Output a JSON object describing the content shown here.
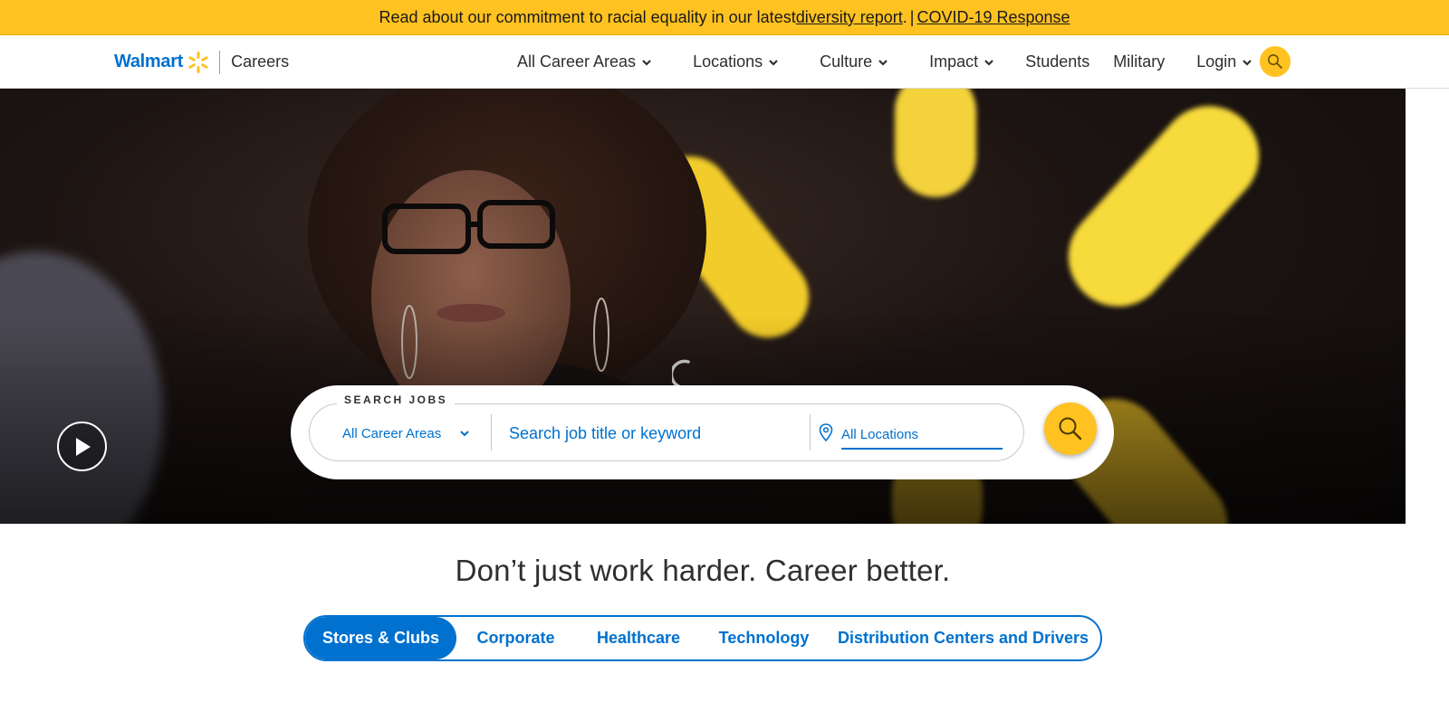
{
  "announcement": {
    "text": "Read about our commitment to racial equality in our latest ",
    "diversity_link": "diversity report",
    "period": ".",
    "separator": "|",
    "covid_link": "COVID-19 Response"
  },
  "brand": {
    "name": "Walmart",
    "section": "Careers",
    "spark_icon": "walmart-spark-icon",
    "spark_color": "#ffc220",
    "brand_color": "#0071ce"
  },
  "nav": {
    "items": [
      {
        "label": "All Career Areas",
        "has_dropdown": true
      },
      {
        "label": "Locations",
        "has_dropdown": true
      },
      {
        "label": "Culture",
        "has_dropdown": true
      },
      {
        "label": "Impact",
        "has_dropdown": true
      },
      {
        "label": "Students",
        "has_dropdown": false
      },
      {
        "label": "Military",
        "has_dropdown": false
      },
      {
        "label": "Login",
        "has_dropdown": true
      }
    ],
    "search_icon": "search-icon"
  },
  "hero": {
    "play_icon": "play-icon",
    "loading_icon": "loading-spinner-icon"
  },
  "search": {
    "legend": "SEARCH JOBS",
    "career_area_selected": "All Career Areas",
    "keyword_placeholder": "Search job title or keyword",
    "location_placeholder": "All Locations",
    "location_icon": "map-pin-icon",
    "submit_icon": "search-icon"
  },
  "tagline": "Don’t just work harder. Career better.",
  "tabs": [
    {
      "label": "Stores & Clubs",
      "active": true
    },
    {
      "label": "Corporate",
      "active": false
    },
    {
      "label": "Healthcare",
      "active": false
    },
    {
      "label": "Technology",
      "active": false
    },
    {
      "label": "Distribution Centers and Drivers",
      "active": false
    }
  ],
  "colors": {
    "accent_yellow": "#ffc220",
    "brand_blue": "#0071ce",
    "text_dark": "#2e2f32"
  }
}
